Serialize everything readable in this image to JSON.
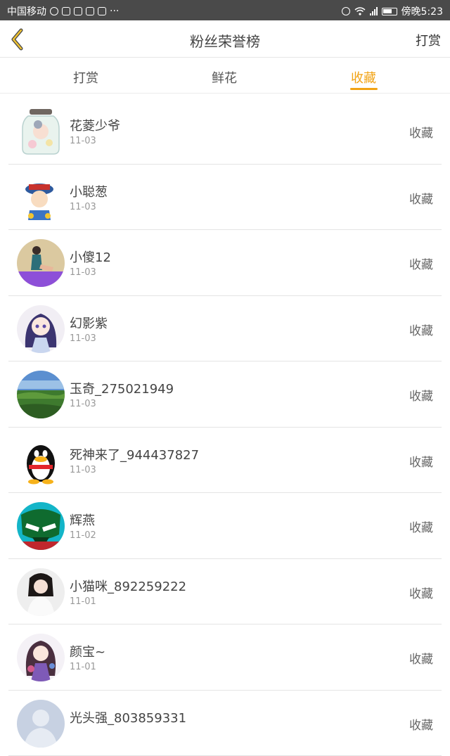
{
  "status_bar": {
    "carrier": "中国移动",
    "time": "傍晚5:23",
    "icons": [
      "weibo-icon",
      "app-icon",
      "wechat-icon",
      "app-icon",
      "app-icon",
      "more-icon",
      "alarm-icon",
      "wifi-icon",
      "signal-icon",
      "battery-icon"
    ]
  },
  "nav": {
    "back_icon": "chevron-left-icon",
    "title": "粉丝荣誉榜",
    "right_label": "打赏"
  },
  "tabs": [
    {
      "label": "打赏",
      "active": false
    },
    {
      "label": "鲜花",
      "active": false
    },
    {
      "label": "收藏",
      "active": true
    }
  ],
  "accent_color": "#f2a314",
  "fans": [
    {
      "name": "花菱少爷",
      "date": "11-03",
      "action": "收藏",
      "avatar": "jar-avatar"
    },
    {
      "name": "小聪葱",
      "date": "11-03",
      "action": "收藏",
      "avatar": "cartoon-avatar"
    },
    {
      "name": "小傻12",
      "date": "11-03",
      "action": "收藏",
      "avatar": "photo-avatar"
    },
    {
      "name": "幻影紫",
      "date": "11-03",
      "action": "收藏",
      "avatar": "anime-avatar"
    },
    {
      "name": "玉奇_275021949",
      "date": "11-03",
      "action": "收藏",
      "avatar": "landscape-avatar"
    },
    {
      "name": "死神来了_944437827",
      "date": "11-03",
      "action": "收藏",
      "avatar": "penguin-avatar"
    },
    {
      "name": "辉燕",
      "date": "11-02",
      "action": "收藏",
      "avatar": "robot-avatar"
    },
    {
      "name": "小猫咪_892259222",
      "date": "11-01",
      "action": "收藏",
      "avatar": "portrait-avatar"
    },
    {
      "name": "颜宝~",
      "date": "11-01",
      "action": "收藏",
      "avatar": "anime-girl-avatar"
    },
    {
      "name": "光头强_803859331",
      "date": "",
      "action": "收藏",
      "avatar": "default-avatar"
    }
  ]
}
